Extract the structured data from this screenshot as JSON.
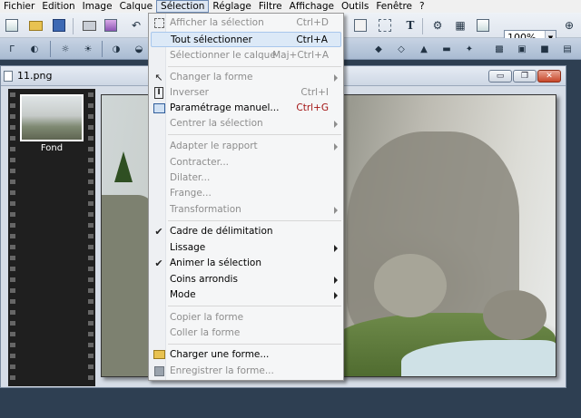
{
  "menubar": {
    "items": [
      "Fichier",
      "Edition",
      "Image",
      "Calque",
      "Sélection",
      "Réglage",
      "Filtre",
      "Affichage",
      "Outils",
      "Fenêtre",
      "?"
    ],
    "active_index": 4
  },
  "toolbar": {
    "zoom_value": "100%"
  },
  "document": {
    "title": "11.png",
    "thumb_label": "Fond",
    "minimize_glyph": "▭",
    "restore_glyph": "❐",
    "close_glyph": "✕"
  },
  "menu": {
    "items": [
      {
        "label": "Afficher la sélection",
        "shortcut": "Ctrl+D",
        "disabled": true,
        "icon": "show-selection-icon"
      },
      {
        "label": "Tout sélectionner",
        "shortcut": "Ctrl+A",
        "highlighted": true
      },
      {
        "label": "Sélectionner le calque",
        "shortcut": "Maj+Ctrl+A",
        "disabled": true
      },
      {
        "label": "Changer la forme",
        "submenu": true,
        "disabled": true,
        "icon": "pointer-icon"
      },
      {
        "label": "Inverser",
        "shortcut": "Ctrl+I",
        "disabled": true,
        "icon": "invert-icon"
      },
      {
        "label": "Paramétrage manuel...",
        "shortcut": "Ctrl+G",
        "shortcut_color": "#a31414",
        "icon": "manual-settings-icon"
      },
      {
        "label": "Centrer la sélection",
        "submenu": true,
        "disabled": true
      },
      {
        "label": "Adapter le rapport",
        "submenu": true,
        "disabled": true
      },
      {
        "label": "Contracter...",
        "disabled": true
      },
      {
        "label": "Dilater...",
        "disabled": true
      },
      {
        "label": "Frange...",
        "disabled": true
      },
      {
        "label": "Transformation",
        "submenu": true,
        "disabled": true
      },
      {
        "label": "Cadre de délimitation",
        "checked": true
      },
      {
        "label": "Lissage",
        "submenu": true
      },
      {
        "label": "Animer la sélection",
        "checked": true
      },
      {
        "label": "Coins arrondis",
        "submenu": true
      },
      {
        "label": "Mode",
        "submenu": true
      },
      {
        "label": "Copier la forme",
        "disabled": true
      },
      {
        "label": "Coller la forme",
        "disabled": true
      },
      {
        "label": "Charger une forme...",
        "icon": "open-folder-icon"
      },
      {
        "label": "Enregistrer la forme...",
        "disabled": true,
        "icon": "save-disk-icon"
      }
    ],
    "check_glyph": "✔"
  }
}
